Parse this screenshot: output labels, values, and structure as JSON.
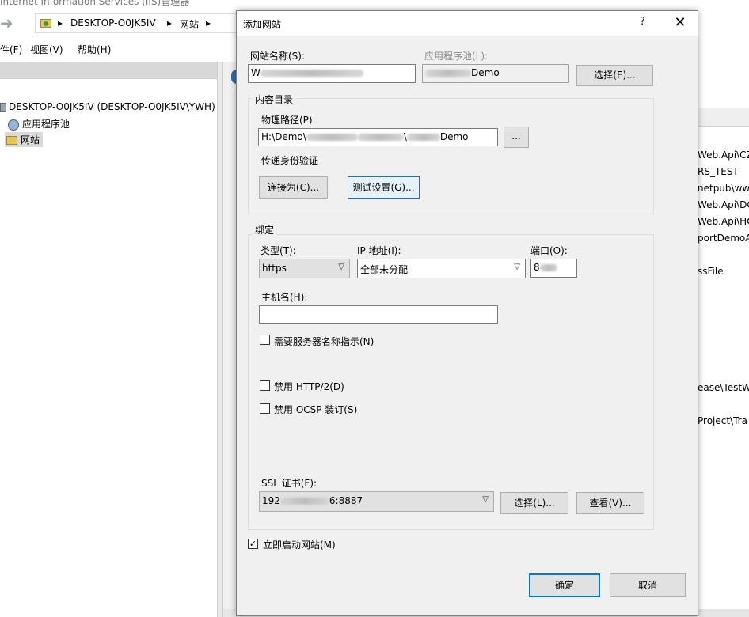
{
  "iis": {
    "title": "Internet Information Services (IIS)管理器",
    "breadcrumb": [
      "DESKTOP-O0JK5IV",
      "网站"
    ],
    "menu": [
      "件(F)",
      "视图(V)",
      "帮助(H)"
    ],
    "tree": {
      "server": "DESKTOP-O0JK5IV (DESKTOP-O0JK5IV\\YWH)",
      "app_pools": "应用程序池",
      "sites": "网站"
    },
    "right_list": [
      "Web.Api\\CZ",
      "RS_TEST",
      "netpub\\www",
      "Web.Api\\DC",
      "Web.Api\\HC",
      "portDemoA",
      "ssFile",
      "ease\\TestW",
      "Project\\Tra"
    ]
  },
  "dialog": {
    "title": "添加网站",
    "help": "?",
    "close": "✕",
    "site_name": {
      "label": "网站名称(S):",
      "value_prefix": "W",
      "value_suffix": ""
    },
    "app_pool": {
      "label": "应用程序池(L):",
      "value_suffix": "Demo"
    },
    "select_pool_button": "选择(E)...",
    "content_dir": {
      "group": "内容目录",
      "physical_path_label": "物理路径(P):",
      "physical_path_start": "H:\\Demo\\",
      "physical_path_mid": "\\",
      "physical_path_end": "Demo",
      "browse_button": "...",
      "pass_through_label": "传递身份验证",
      "connect_as_button": "连接为(C)...",
      "test_settings_button": "测试设置(G)..."
    },
    "binding": {
      "group": "绑定",
      "type_label": "类型(T):",
      "type_value": "https",
      "ip_label": "IP 地址(I):",
      "ip_value": "全部未分配",
      "port_label": "端口(O):",
      "port_value": "8",
      "host_label": "主机名(H):",
      "host_value": "",
      "sni_label": "需要服务器名称指示(N)",
      "disable_http2_label": "禁用 HTTP/2(D)",
      "disable_ocsp_label": "禁用 OCSP 装订(S)",
      "ssl_label": "SSL 证书(F):",
      "ssl_value_prefix": "192",
      "ssl_value_suffix": "6:8887",
      "ssl_select_button": "选择(L)...",
      "ssl_view_button": "查看(V)..."
    },
    "start_now_label": "立即启动网站(M)",
    "start_now_checked": true,
    "ok_button": "确定",
    "cancel_button": "取消"
  }
}
